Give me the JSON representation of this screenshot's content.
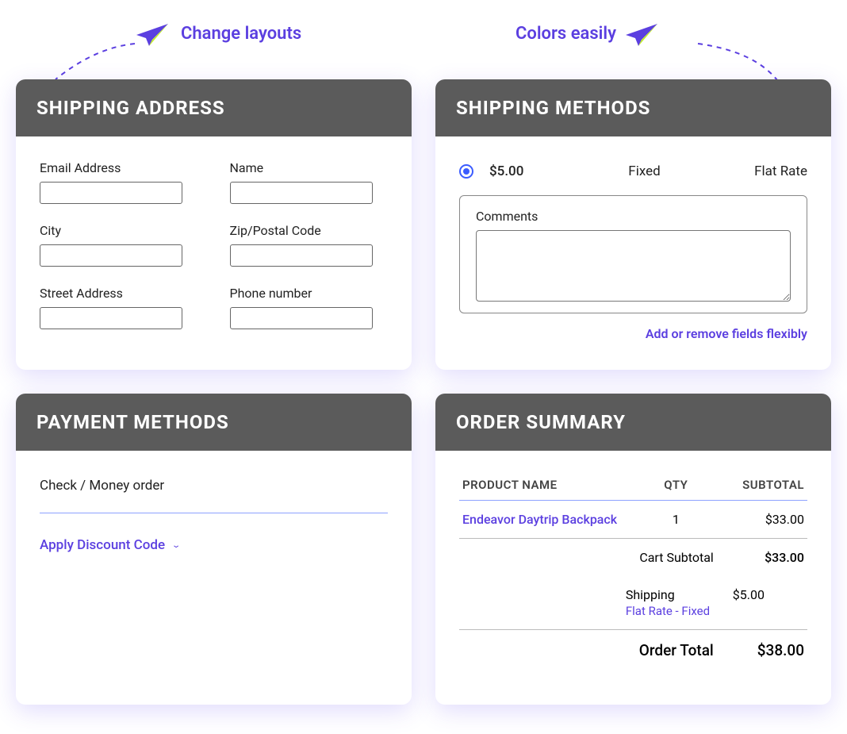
{
  "annotations": {
    "left": "Change layouts",
    "right": "Colors easily",
    "flex_note": "Add or remove fields flexibly"
  },
  "shipping_address": {
    "title": "Shipping Address",
    "fields": {
      "email": "Email Address",
      "name": "Name",
      "city": "City",
      "zip": "Zip/Postal Code",
      "street": "Street Address",
      "phone": "Phone number"
    }
  },
  "shipping_methods": {
    "title": "Shipping Methods",
    "option": {
      "price": "$5.00",
      "carrier": "Fixed",
      "method": "Flat Rate"
    },
    "comments_label": "Comments"
  },
  "payment_methods": {
    "title": "Payment Methods",
    "option": "Check / Money order",
    "discount": "Apply Discount Code"
  },
  "order_summary": {
    "title": "Order Summary",
    "headers": {
      "product": "Product Name",
      "qty": "Qty",
      "subtotal": "Subtotal"
    },
    "item": {
      "name": "Endeavor Daytrip Backpack",
      "qty": "1",
      "subtotal": "$33.00"
    },
    "cart_subtotal": {
      "label": "Cart Subtotal",
      "value": "$33.00"
    },
    "shipping": {
      "label": "Shipping",
      "detail": "Flat Rate - Fixed",
      "value": "$5.00"
    },
    "order_total": {
      "label": "Order Total",
      "value": "$38.00"
    }
  }
}
